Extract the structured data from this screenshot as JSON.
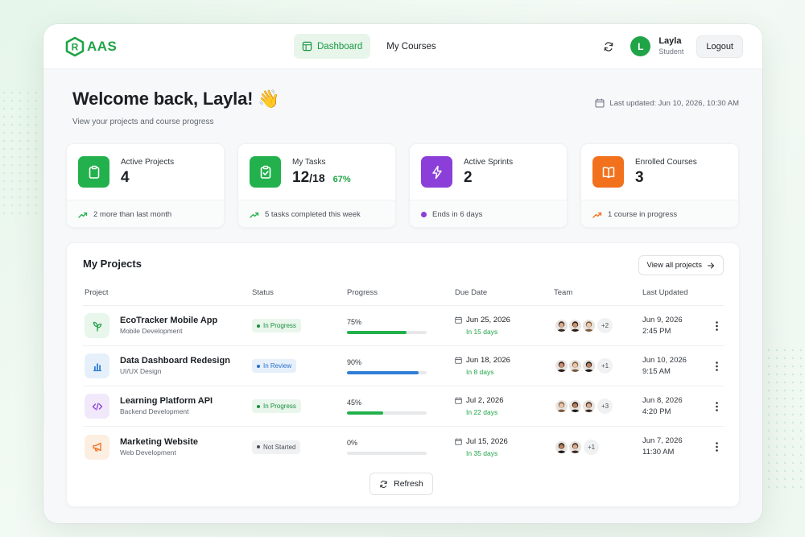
{
  "brand": {
    "logo_letter": "R",
    "name": "AAS",
    "color": "#1fa447"
  },
  "nav": {
    "items": [
      {
        "label": "Dashboard",
        "icon": "dashboard-icon",
        "active": true
      },
      {
        "label": "My Courses",
        "active": false
      }
    ]
  },
  "user": {
    "initial": "L",
    "name": "Layla",
    "role": "Student",
    "logout_label": "Logout"
  },
  "welcome": {
    "title": "Welcome back, Layla! 👋",
    "subtitle": "View your projects and course progress",
    "last_updated": "Last updated: Jun 10, 2026, 10:30 AM"
  },
  "stats": [
    {
      "label": "Active Projects",
      "value": "4",
      "footer": "2 more than last month",
      "icon": "clipboard-icon",
      "color": "#22b14c"
    },
    {
      "label": "My Tasks",
      "value": "12",
      "value_sub": "/18",
      "pct": "67%",
      "footer": "5 tasks completed this week",
      "icon": "clipboard-check-icon",
      "color": "#22b14c"
    },
    {
      "label": "Active Sprints",
      "value": "2",
      "footer": "Ends in 6 days",
      "icon": "lightning-icon",
      "color": "#8b3fd8"
    },
    {
      "label": "Enrolled Courses",
      "value": "3",
      "footer": "1 course in progress",
      "icon": "book-icon",
      "color": "#f2711c"
    }
  ],
  "projects": {
    "title": "My Projects",
    "view_all_label": "View all projects",
    "columns": [
      "Project",
      "Status",
      "Progress",
      "Due Date",
      "Team",
      "Last Updated"
    ],
    "rows": [
      {
        "name": "EcoTracker Mobile App",
        "category": "Mobile Development",
        "icon": "leaf-icon",
        "icon_color": "#22a04b",
        "icon_bg": "#e8f6ec",
        "status": "In Progress",
        "progress_label": "75%",
        "progress": 0.75,
        "bar_color": "#22b14c",
        "due_date": "Jun 25, 2026",
        "due_in": "In 15 days",
        "team_extra": "+2",
        "team_count": 3,
        "updated_date": "Jun 9, 2026",
        "updated_time": "2:45 PM"
      },
      {
        "name": "Data Dashboard Redesign",
        "category": "UI/UX Design",
        "icon": "bar-chart-icon",
        "icon_color": "#2f7ed8",
        "icon_bg": "#e6f0fb",
        "status": "In Review",
        "progress_label": "90%",
        "progress": 0.9,
        "bar_color": "#2f7ed8",
        "due_date": "Jun 18, 2026",
        "due_in": "In 8 days",
        "team_extra": "+1",
        "team_count": 3,
        "updated_date": "Jun 10, 2026",
        "updated_time": "9:15 AM"
      },
      {
        "name": "Learning Platform API",
        "category": "Backend Development",
        "icon": "code-icon",
        "icon_color": "#8b3fd8",
        "icon_bg": "#f1e9fb",
        "status": "In Progress",
        "progress_label": "45%",
        "progress": 0.45,
        "bar_color": "#22b14c",
        "due_date": "Jul 2, 2026",
        "due_in": "In 22 days",
        "team_extra": "+3",
        "team_count": 3,
        "updated_date": "Jun 8, 2026",
        "updated_time": "4:20 PM"
      },
      {
        "name": "Marketing Website",
        "category": "Web Development",
        "icon": "megaphone-icon",
        "icon_color": "#f2711c",
        "icon_bg": "#fdeee2",
        "status": "Not Started",
        "progress_label": "0%",
        "progress": 0,
        "bar_color": "#22b14c",
        "due_date": "Jul 15, 2026",
        "due_in": "In 35 days",
        "team_extra": "+1",
        "team_count": 2,
        "updated_date": "Jun 7, 2026",
        "updated_time": "11:30 AM"
      }
    ],
    "refresh_label": "Refresh"
  }
}
